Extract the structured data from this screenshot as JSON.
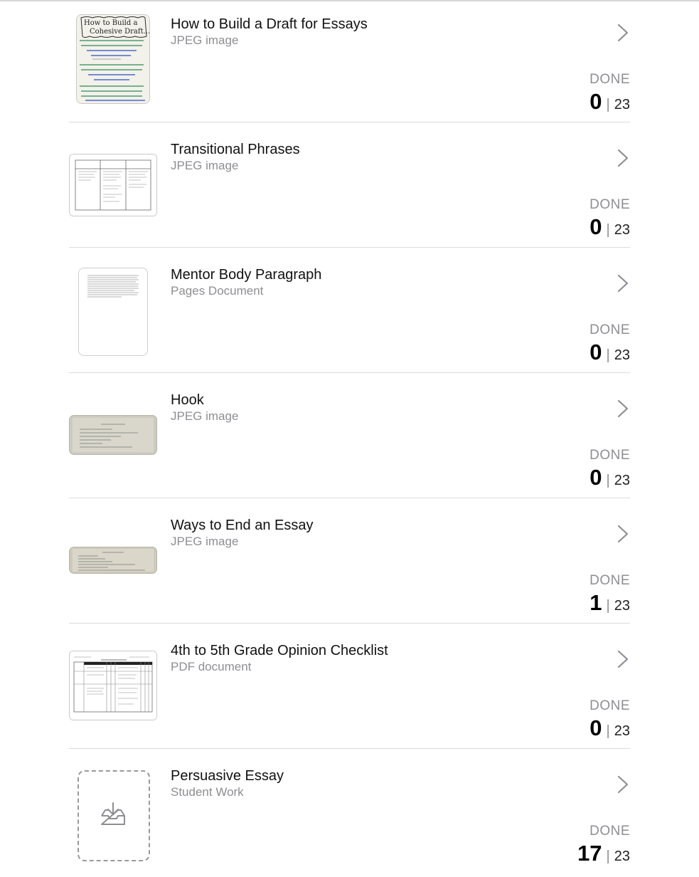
{
  "items": [
    {
      "title": "How to Build a Draft for Essays",
      "subtitle": "JPEG image",
      "status_label": "DONE",
      "done": "0",
      "separator": "|",
      "total": "23",
      "thumb_lines": [
        "How to Build a",
        "Cohesive Draft..."
      ]
    },
    {
      "title": "Transitional Phrases",
      "subtitle": "JPEG image",
      "status_label": "DONE",
      "done": "0",
      "separator": "|",
      "total": "23"
    },
    {
      "title": "Mentor Body Paragraph",
      "subtitle": "Pages Document",
      "status_label": "DONE",
      "done": "0",
      "separator": "|",
      "total": "23"
    },
    {
      "title": "Hook",
      "subtitle": "JPEG image",
      "status_label": "DONE",
      "done": "0",
      "separator": "|",
      "total": "23"
    },
    {
      "title": "Ways to End an Essay",
      "subtitle": "JPEG image",
      "status_label": "DONE",
      "done": "1",
      "separator": "|",
      "total": "23"
    },
    {
      "title": "4th to 5th Grade Opinion Checklist",
      "subtitle": "PDF document",
      "status_label": "DONE",
      "done": "0",
      "separator": "|",
      "total": "23"
    },
    {
      "title": "Persuasive Essay",
      "subtitle": "Student Work",
      "status_label": "DONE",
      "done": "17",
      "separator": "|",
      "total": "23"
    }
  ],
  "icons": {
    "chevron": "chevron-right-icon",
    "submit": "tray-download-icon"
  },
  "colors": {
    "secondary_text": "#8e8e93",
    "divider": "#dcdcdc",
    "chevron": "#8e8e93"
  }
}
